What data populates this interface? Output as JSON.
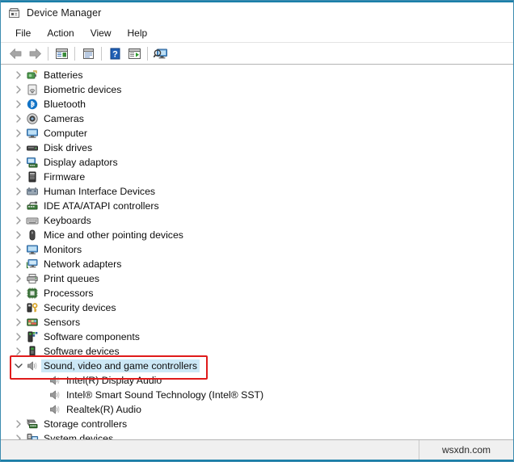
{
  "window": {
    "title": "Device Manager",
    "title_icon": "device-manager-icon",
    "accent_color": "#1b7fa8",
    "selection_color": "#cce8f6",
    "annotation_color": "#e01b1b"
  },
  "menubar": {
    "items": [
      {
        "label": "File",
        "name": "menu-file"
      },
      {
        "label": "Action",
        "name": "menu-action"
      },
      {
        "label": "View",
        "name": "menu-view"
      },
      {
        "label": "Help",
        "name": "menu-help"
      }
    ]
  },
  "toolbar": {
    "buttons": [
      {
        "name": "back-button",
        "icon": "back-arrow-icon",
        "title": "Back"
      },
      {
        "name": "forward-button",
        "icon": "forward-arrow-icon",
        "title": "Forward"
      },
      {
        "name": "show-hide-console-tree-button",
        "icon": "console-tree-icon",
        "title": "Show/Hide Console Tree"
      },
      {
        "name": "properties-button",
        "icon": "properties-icon",
        "title": "Properties"
      },
      {
        "name": "help-button",
        "icon": "help-question-icon",
        "title": "Help"
      },
      {
        "name": "update-driver-button",
        "icon": "update-driver-icon",
        "title": "Update Driver"
      },
      {
        "name": "scan-for-hardware-changes-button",
        "icon": "scan-hardware-icon",
        "title": "Scan for hardware changes"
      }
    ]
  },
  "tree": {
    "rows": [
      {
        "label": "Batteries",
        "icon": "battery-icon",
        "level": 0,
        "expandable": true,
        "expanded": false,
        "selected": false
      },
      {
        "label": "Biometric devices",
        "icon": "fingerprint-icon",
        "level": 0,
        "expandable": true,
        "expanded": false,
        "selected": false
      },
      {
        "label": "Bluetooth",
        "icon": "bluetooth-icon",
        "level": 0,
        "expandable": true,
        "expanded": false,
        "selected": false
      },
      {
        "label": "Cameras",
        "icon": "camera-icon",
        "level": 0,
        "expandable": true,
        "expanded": false,
        "selected": false
      },
      {
        "label": "Computer",
        "icon": "computer-icon",
        "level": 0,
        "expandable": true,
        "expanded": false,
        "selected": false
      },
      {
        "label": "Disk drives",
        "icon": "disk-drive-icon",
        "level": 0,
        "expandable": true,
        "expanded": false,
        "selected": false
      },
      {
        "label": "Display adaptors",
        "icon": "display-adaptor-icon",
        "level": 0,
        "expandable": true,
        "expanded": false,
        "selected": false
      },
      {
        "label": "Firmware",
        "icon": "firmware-icon",
        "level": 0,
        "expandable": true,
        "expanded": false,
        "selected": false
      },
      {
        "label": "Human Interface Devices",
        "icon": "hid-icon",
        "level": 0,
        "expandable": true,
        "expanded": false,
        "selected": false
      },
      {
        "label": "IDE ATA/ATAPI controllers",
        "icon": "ide-controller-icon",
        "level": 0,
        "expandable": true,
        "expanded": false,
        "selected": false
      },
      {
        "label": "Keyboards",
        "icon": "keyboard-icon",
        "level": 0,
        "expandable": true,
        "expanded": false,
        "selected": false
      },
      {
        "label": "Mice and other pointing devices",
        "icon": "mouse-icon",
        "level": 0,
        "expandable": true,
        "expanded": false,
        "selected": false
      },
      {
        "label": "Monitors",
        "icon": "monitor-icon",
        "level": 0,
        "expandable": true,
        "expanded": false,
        "selected": false
      },
      {
        "label": "Network adapters",
        "icon": "network-adapter-icon",
        "level": 0,
        "expandable": true,
        "expanded": false,
        "selected": false
      },
      {
        "label": "Print queues",
        "icon": "printer-icon",
        "level": 0,
        "expandable": true,
        "expanded": false,
        "selected": false
      },
      {
        "label": "Processors",
        "icon": "processor-icon",
        "level": 0,
        "expandable": true,
        "expanded": false,
        "selected": false
      },
      {
        "label": "Security devices",
        "icon": "security-key-icon",
        "level": 0,
        "expandable": true,
        "expanded": false,
        "selected": false
      },
      {
        "label": "Sensors",
        "icon": "sensor-icon",
        "level": 0,
        "expandable": true,
        "expanded": false,
        "selected": false
      },
      {
        "label": "Software components",
        "icon": "software-component-icon",
        "level": 0,
        "expandable": true,
        "expanded": false,
        "selected": false
      },
      {
        "label": "Software devices",
        "icon": "software-device-icon",
        "level": 0,
        "expandable": true,
        "expanded": false,
        "selected": false
      },
      {
        "label": "Sound, video and game controllers",
        "icon": "speaker-icon",
        "level": 0,
        "expandable": true,
        "expanded": true,
        "selected": true
      },
      {
        "label": "Intel(R) Display Audio",
        "icon": "speaker-icon",
        "level": 1,
        "expandable": false,
        "expanded": false,
        "selected": false
      },
      {
        "label": "Intel® Smart Sound Technology (Intel® SST)",
        "icon": "speaker-icon",
        "level": 1,
        "expandable": false,
        "expanded": false,
        "selected": false
      },
      {
        "label": "Realtek(R) Audio",
        "icon": "speaker-icon",
        "level": 1,
        "expandable": false,
        "expanded": false,
        "selected": false
      },
      {
        "label": "Storage controllers",
        "icon": "storage-controller-icon",
        "level": 0,
        "expandable": true,
        "expanded": false,
        "selected": false
      },
      {
        "label": "System devices",
        "icon": "system-device-icon",
        "level": 0,
        "expandable": true,
        "expanded": false,
        "selected": false
      }
    ]
  },
  "annotation": {
    "name": "sound-video-game-controllers-highlight-box",
    "target_label": "Sound, video and game controllers"
  },
  "statusbar": {
    "left_text": "",
    "right_text": "wsxdn.com"
  }
}
